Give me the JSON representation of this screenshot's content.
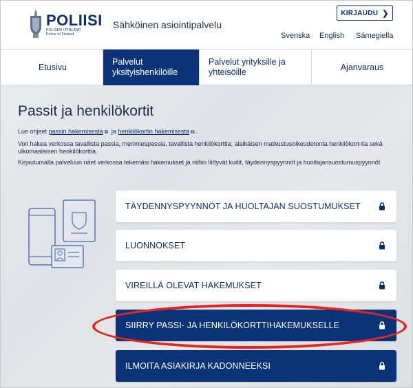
{
  "header": {
    "logo_main": "POLIISI",
    "logo_sub": "POLISEN I FINLAND",
    "logo_sub2": "Police of Finland",
    "service_name": "Sähköinen asiointipalvelu",
    "login_label": "KIRJAUDU",
    "languages": [
      "Svenska",
      "English",
      "Sámegiella"
    ]
  },
  "nav": {
    "items": [
      {
        "label": "Etusivu"
      },
      {
        "label": "Palvelut yksityishenkilöille"
      },
      {
        "label": "Palvelut yrityksille ja yhteisöille"
      },
      {
        "label": "Ajanvaraus"
      }
    ]
  },
  "main": {
    "title": "Passit ja henkilökortit",
    "intro_prefix": "Lue ohjeet",
    "link_passport": "passin hakemisesta",
    "intro_and": "ja",
    "link_idcard": "henkilökortin hakemisesta",
    "intro_suffix": ".",
    "para1": "Voit hakea verkossa tavallista passia, merimiespassia, tavallista henkilökorttia, alaikäisen matkustusoikeudetonta henkilökort-tia sekä ulkomaalaisen henkilökorttia.",
    "para2": "Kirjautumalla palveluun näet verkossa tekemäsi hakemukset ja niihin liittyvät kuitit, täydennyspyynnöt ja huoltajansuostumuspyynnöt"
  },
  "actions": [
    {
      "label": "TÄYDENNYSPYYNNÖT JA HUOLTAJAN SUOSTUMUKSET",
      "style": "light"
    },
    {
      "label": "LUONNOKSET",
      "style": "light"
    },
    {
      "label": "VIREILLÄ OLEVAT HAKEMUKSET",
      "style": "light"
    },
    {
      "label": "SIIRRY PASSI- JA HENKILÖKORTTIHAKEMUKSELLE",
      "style": "dark"
    },
    {
      "label": "ILMOITA ASIAKIRJA KADONNEEKSI",
      "style": "dark"
    }
  ],
  "colors": {
    "brand_blue": "#0b3478",
    "highlight_red": "#e62420"
  },
  "icons": [
    "police-emblem-icon",
    "chevron-right-icon",
    "external-link-icon",
    "lock-icon",
    "documents-illustration"
  ]
}
